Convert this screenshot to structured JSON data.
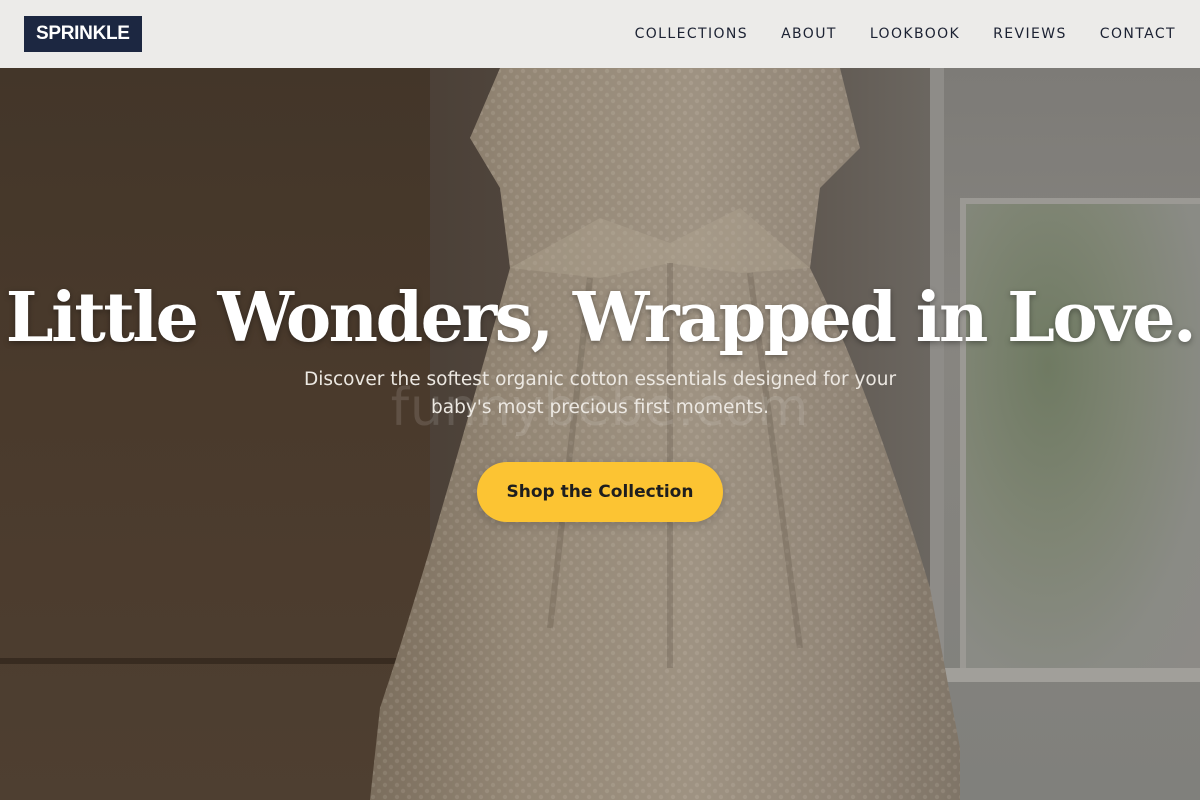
{
  "brand": {
    "logo_text": "SPRINKLE"
  },
  "nav": {
    "items": [
      {
        "label": "COLLECTIONS"
      },
      {
        "label": "ABOUT"
      },
      {
        "label": "LOOKBOOK"
      },
      {
        "label": "REVIEWS"
      },
      {
        "label": "CONTACT"
      }
    ]
  },
  "hero": {
    "title": "Little Wonders, Wrapped in Love.",
    "subtitle": "Discover the softest organic cotton essentials designed for your baby's most precious first moments.",
    "cta_label": "Shop the Collection",
    "watermark": "funnybebe.com"
  },
  "colors": {
    "logo_bg": "#1c2741",
    "header_bg": "#f3f2f0",
    "nav_text": "#1c2233",
    "cta_bg": "#fcc433",
    "cta_text": "#1e1e1e",
    "hero_text": "#ffffff"
  }
}
